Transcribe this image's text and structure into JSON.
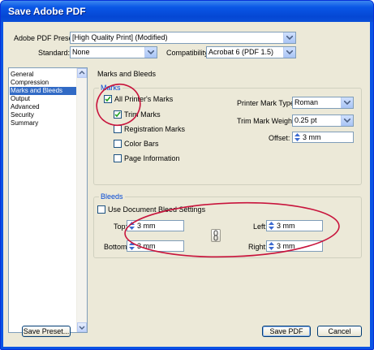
{
  "window": {
    "title": "Save Adobe PDF"
  },
  "preset": {
    "label": "Adobe PDF Preset:",
    "value": "[High Quality Print] (Modified)"
  },
  "standard": {
    "label": "Standard:",
    "value": "None"
  },
  "compatibility": {
    "label": "Compatibility:",
    "value": "Acrobat 6 (PDF 1.5)"
  },
  "sidebar": {
    "items": [
      {
        "label": "General",
        "selected": false
      },
      {
        "label": "Compression",
        "selected": false
      },
      {
        "label": "Marks and Bleeds",
        "selected": true
      },
      {
        "label": "Output",
        "selected": false
      },
      {
        "label": "Advanced",
        "selected": false
      },
      {
        "label": "Security",
        "selected": false
      },
      {
        "label": "Summary",
        "selected": false
      }
    ]
  },
  "panel": {
    "title": "Marks and Bleeds"
  },
  "marks": {
    "group_title": "Marks",
    "all_printers_marks": {
      "label": "All Printer's Marks",
      "checked": true
    },
    "trim_marks": {
      "label": "Trim Marks",
      "checked": true
    },
    "registration_marks": {
      "label": "Registration Marks",
      "checked": false
    },
    "color_bars": {
      "label": "Color Bars",
      "checked": false
    },
    "page_information": {
      "label": "Page Information",
      "checked": false
    },
    "printer_mark_type": {
      "label": "Printer Mark Type:",
      "value": "Roman"
    },
    "trim_mark_weight": {
      "label": "Trim Mark Weight:",
      "value": "0.25 pt"
    },
    "offset": {
      "label": "Offset:",
      "value": "3 mm"
    }
  },
  "bleeds": {
    "group_title": "Bleeds",
    "use_document": {
      "label": "Use Document Bleed Settings",
      "checked": false
    },
    "top": {
      "label": "Top:",
      "value": "3 mm"
    },
    "bottom": {
      "label": "Bottom:",
      "value": "3 mm"
    },
    "left": {
      "label": "Left:",
      "value": "3 mm"
    },
    "right": {
      "label": "Right:",
      "value": "3 mm"
    }
  },
  "buttons": {
    "save_preset": "Save Preset...",
    "save_pdf": "Save PDF",
    "cancel": "Cancel"
  },
  "colors": {
    "title_bar": "#0a54e4",
    "selection": "#316ac5",
    "annotation": "#c8143c",
    "group_title": "#0046d5"
  }
}
